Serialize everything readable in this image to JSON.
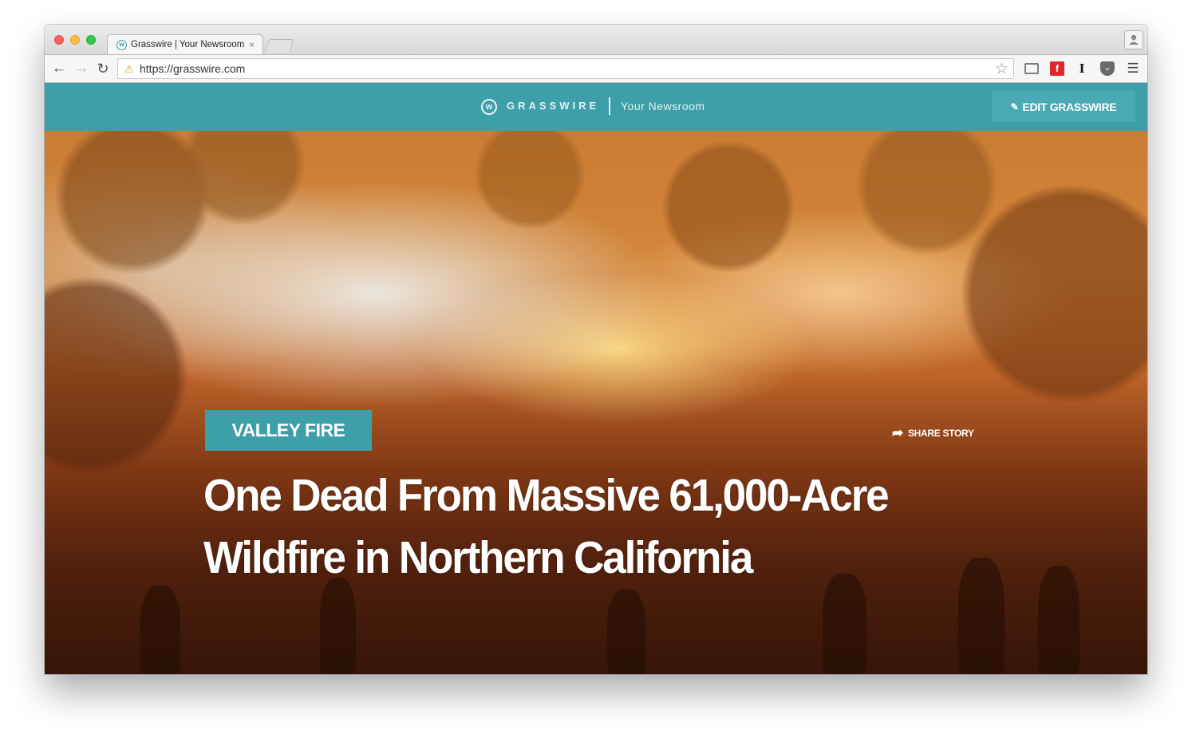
{
  "browser": {
    "tab_title": "Grasswire | Your Newsroom",
    "tab_close": "×",
    "url": "https://grasswire.com",
    "icons": {
      "back": "arrow-left-icon",
      "forward": "arrow-right-icon",
      "reload": "reload-icon",
      "lock": "lock-icon",
      "bookmark": "star-icon",
      "extensions": [
        "cast-icon",
        "flipboard-icon",
        "instapaper-icon",
        "pocket-icon",
        "menu-icon"
      ]
    }
  },
  "site": {
    "brand_name": "GRASSWIRE",
    "tagline": "Your Newsroom",
    "edit_button": "EDIT GRASSWIRE",
    "accent_color": "#3d9fa9"
  },
  "story": {
    "category": "VALLEY FIRE",
    "share_label": "SHARE STORY",
    "headline": "One Dead From Massive 61,000-Acre Wildfire in Northern California"
  }
}
